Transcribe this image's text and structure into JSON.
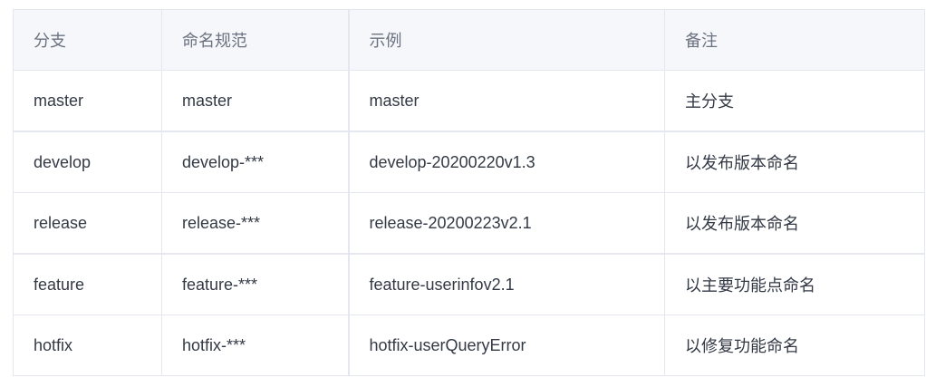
{
  "table": {
    "headers": [
      "分支",
      "命名规范",
      "示例",
      "备注"
    ],
    "rows": [
      [
        "master",
        "master",
        "master",
        "主分支"
      ],
      [
        "develop",
        "develop-***",
        "develop-20200220v1.3",
        "以发布版本命名"
      ],
      [
        "release",
        "release-***",
        "release-20200223v2.1",
        "以发布版本命名"
      ],
      [
        "feature",
        "feature-***",
        "feature-userinfov2.1",
        "以主要功能点命名"
      ],
      [
        "hotfix",
        "hotfix-***",
        "hotfix-userQueryError",
        "以修复功能命名"
      ]
    ]
  }
}
